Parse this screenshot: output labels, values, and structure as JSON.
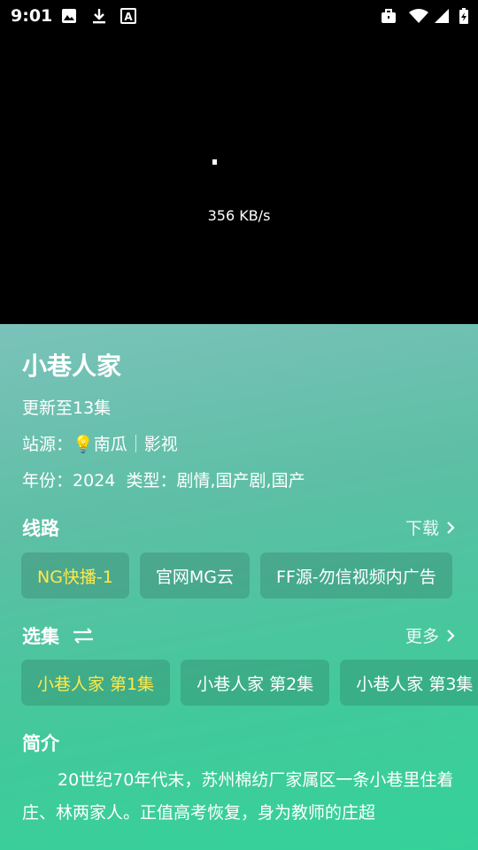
{
  "status_bar": {
    "time": "9:01",
    "left_icons": [
      "image-icon",
      "download-icon",
      "keyboard-a-icon"
    ],
    "right_icons": [
      "work-briefcase-icon",
      "wifi-icon",
      "signal-icon",
      "battery-charging-icon"
    ]
  },
  "player": {
    "speed": "356 KB/s"
  },
  "detail": {
    "title": "小巷人家",
    "update": "更新至13集",
    "source_label": "站源：",
    "source_name": "南瓜",
    "source_type": "影视",
    "year_label": "年份：",
    "year": "2024",
    "genre_label": "类型：",
    "genre": "剧情,国产剧,国产"
  },
  "routes": {
    "heading": "线路",
    "download": "下载",
    "items": [
      {
        "label": "NG快播-1",
        "active": true
      },
      {
        "label": "官网MG云",
        "active": false
      },
      {
        "label": "FF源-勿信视频内广告",
        "active": false
      }
    ]
  },
  "episodes": {
    "heading": "选集",
    "more": "更多",
    "items": [
      {
        "label": "小巷人家 第1集",
        "active": true
      },
      {
        "label": "小巷人家 第2集",
        "active": false
      },
      {
        "label": "小巷人家 第3集",
        "active": false
      }
    ]
  },
  "intro": {
    "heading": "简介",
    "text": "20世纪70年代末，苏州棉纺厂家属区一条小巷里住着庄、林两家人。正值高考恢复，身为教师的庄超"
  },
  "colors": {
    "active_chip_text": "#ffe94a",
    "gradient_top": "#7bc2ba",
    "gradient_bottom": "#34d29a"
  }
}
